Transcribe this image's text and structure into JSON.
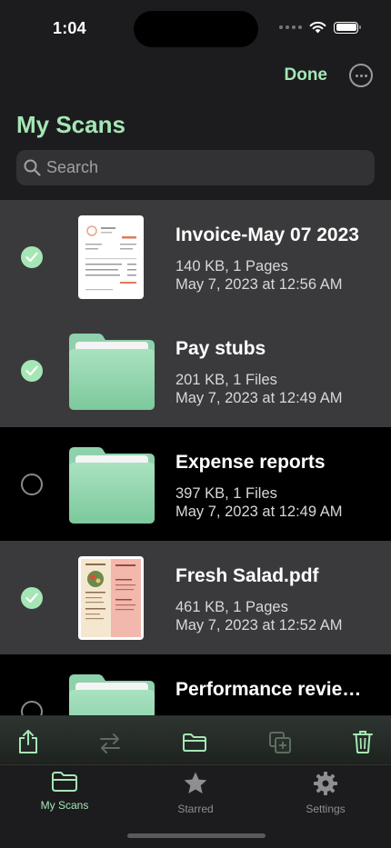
{
  "status": {
    "time": "1:04"
  },
  "header": {
    "done_label": "Done",
    "title": "My Scans"
  },
  "search": {
    "placeholder": "Search"
  },
  "items": [
    {
      "name": "Invoice-May 07 2023",
      "size": "140 KB, 1 Pages",
      "date": "May 7, 2023 at 12:56 AM",
      "type": "document",
      "selected": true
    },
    {
      "name": "Pay stubs",
      "size": "201 KB, 1 Files",
      "date": "May 7, 2023 at 12:49 AM",
      "type": "folder",
      "selected": true
    },
    {
      "name": "Expense reports",
      "size": "397 KB, 1 Files",
      "date": "May 7, 2023 at 12:49 AM",
      "type": "folder",
      "selected": false
    },
    {
      "name": " Fresh Salad.pdf",
      "size": "461 KB, 1 Pages",
      "date": "May 7, 2023 at 12:52 AM",
      "type": "document",
      "selected": true
    },
    {
      "name": "Performance reviews",
      "size": "",
      "date": "",
      "type": "folder",
      "selected": false
    }
  ],
  "toolbar": {
    "icons": [
      "share-icon",
      "transfer-icon",
      "folder-icon",
      "duplicate-icon",
      "trash-icon"
    ]
  },
  "tabs": [
    {
      "label": "My Scans",
      "icon": "folder-icon",
      "active": true
    },
    {
      "label": "Starred",
      "icon": "star-icon",
      "active": false
    },
    {
      "label": "Settings",
      "icon": "gear-icon",
      "active": false
    }
  ],
  "colors": {
    "accent": "#a5e6b5",
    "selected_row": "#3a3a3c",
    "background": "#000000"
  }
}
